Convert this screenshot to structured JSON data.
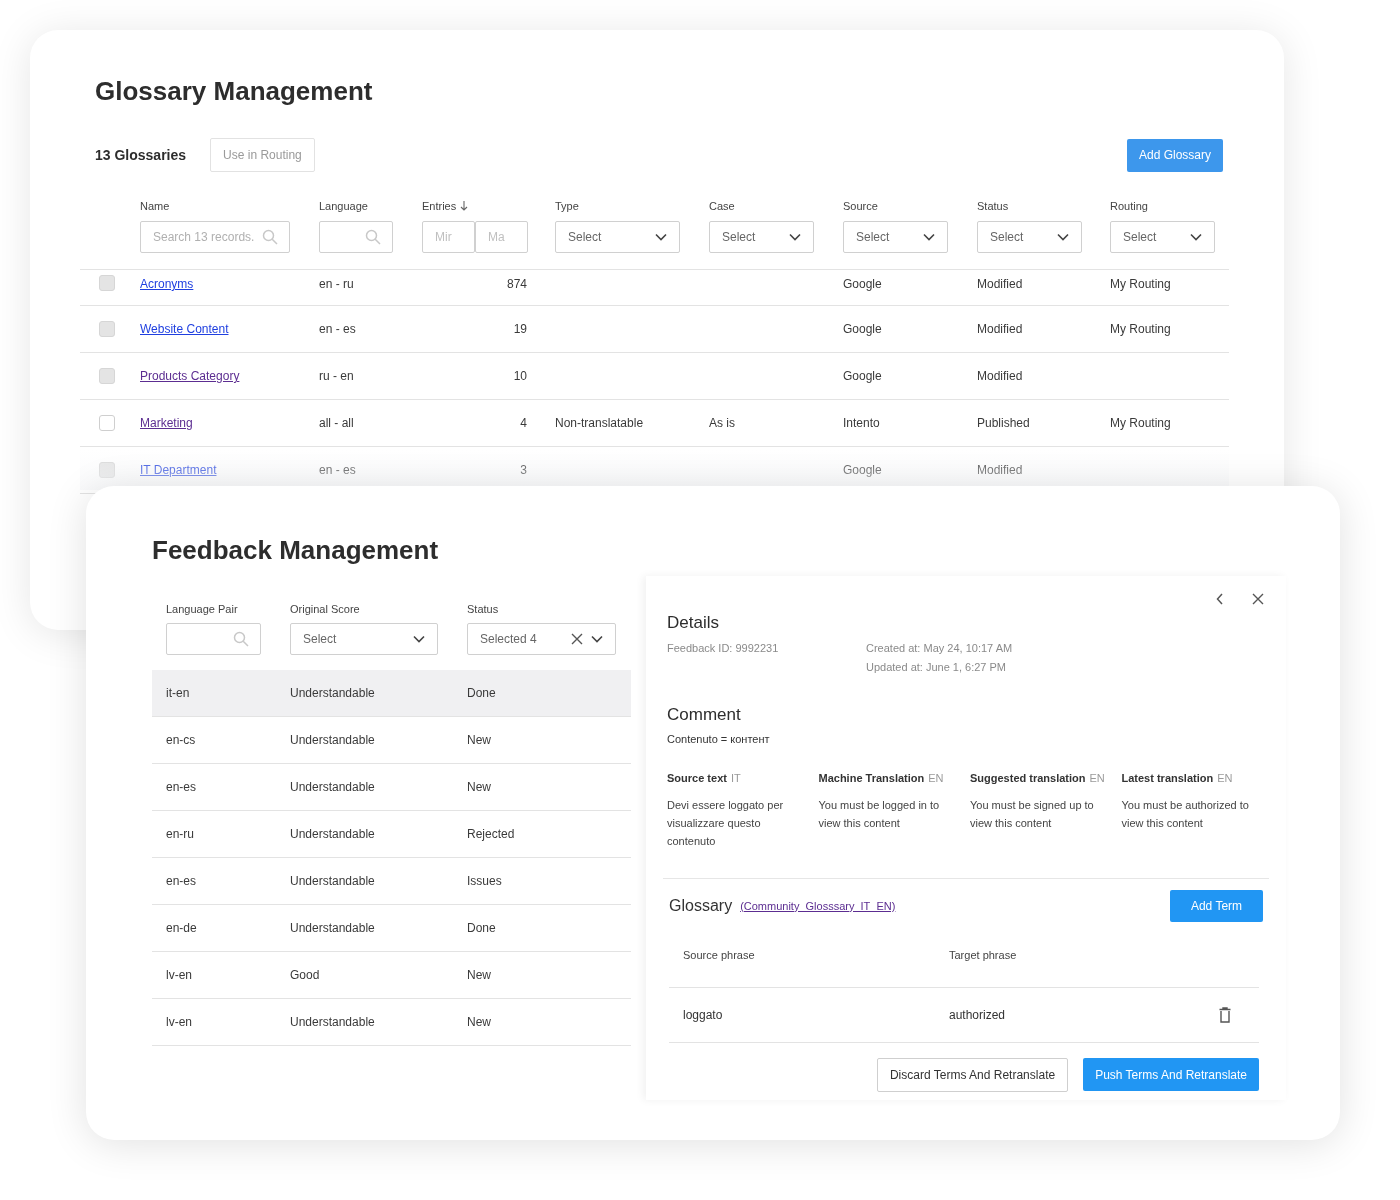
{
  "glossary_window": {
    "title": "Glossary Management",
    "count_label": "13 Glossaries",
    "use_in_routing_button": {
      "label": "Use in Routing",
      "disabled": true
    },
    "add_button": "Add Glossary",
    "columns": [
      {
        "label": "Name",
        "filter": {
          "kind": "search",
          "placeholder": "Search 13 records."
        }
      },
      {
        "label": "Language",
        "filter": {
          "kind": "search"
        }
      },
      {
        "label": "Entries",
        "sorted": true,
        "filter": {
          "kind": "range",
          "placeholders": [
            "Mir",
            "Ma"
          ]
        }
      },
      {
        "label": "Type",
        "filter": {
          "kind": "select",
          "value": "Select"
        }
      },
      {
        "label": "Case",
        "filter": {
          "kind": "select",
          "value": "Select"
        }
      },
      {
        "label": "Source",
        "filter": {
          "kind": "select",
          "value": "Select"
        }
      },
      {
        "label": "Status",
        "filter": {
          "kind": "select",
          "value": "Select"
        }
      },
      {
        "label": "Routing",
        "filter": {
          "kind": "select",
          "value": "Select"
        }
      }
    ],
    "rows": [
      {
        "checked": false,
        "disabled": true,
        "name": "Acronyms",
        "visited": false,
        "language": "en - ru",
        "entries": "874",
        "source": "Google",
        "status": "Modified",
        "routing": "My Routing"
      },
      {
        "checked": false,
        "disabled": true,
        "name": "Website Content",
        "visited": false,
        "language": "en - es",
        "entries": "19",
        "source": "Google",
        "status": "Modified",
        "routing": "My Routing"
      },
      {
        "checked": false,
        "disabled": true,
        "name": "Products Category",
        "visited": true,
        "language": "ru - en",
        "entries": "10",
        "source": "Google",
        "status": "Modified"
      },
      {
        "checked": false,
        "disabled": false,
        "name": "Marketing",
        "visited": true,
        "language": "all - all",
        "entries": "4",
        "type": "Non-translatable",
        "case": "As is",
        "source": "Intento",
        "status": "Published",
        "routing": "My Routing"
      },
      {
        "checked": false,
        "disabled": true,
        "name": "IT Department",
        "visited": false,
        "language": "en - es",
        "entries": "3",
        "source": "Google",
        "status": "Modified"
      }
    ]
  },
  "feedback_window": {
    "title": "Feedback Management",
    "columns": [
      {
        "label": "Language Pair",
        "filter": {
          "kind": "search"
        }
      },
      {
        "label": "Original Score",
        "filter": {
          "kind": "select",
          "value": "Select"
        }
      },
      {
        "label": "Status",
        "filter": {
          "kind": "select",
          "value": "Selected 4",
          "clearable": true
        }
      }
    ],
    "rows": [
      {
        "pair": "it-en",
        "score": "Understandable",
        "status": "Done",
        "selected": true
      },
      {
        "pair": "en-cs",
        "score": "Understandable",
        "status": "New",
        "selected": false
      },
      {
        "pair": "en-es",
        "score": "Understandable",
        "status": "New",
        "selected": false
      },
      {
        "pair": "en-ru",
        "score": "Understandable",
        "status": "Rejected",
        "selected": false
      },
      {
        "pair": "en-es",
        "score": "Understandable",
        "status": "Issues",
        "selected": false
      },
      {
        "pair": "en-de",
        "score": "Understandable",
        "status": "Done",
        "selected": false
      },
      {
        "pair": "lv-en",
        "score": "Good",
        "status": "New",
        "selected": false
      },
      {
        "pair": "lv-en",
        "score": "Understandable",
        "status": "New",
        "selected": false
      }
    ],
    "details": {
      "title": "Details",
      "feedback_id": "Feedback ID: 9992231",
      "created": "Created at: May 24, 10:17 AM",
      "updated": "Updated at: June 1, 6:27 PM",
      "comment_title": "Comment",
      "comment": "Contenuto = контент",
      "translations": [
        {
          "label": "Source text",
          "lang": "IT",
          "text": "Devi essere loggato per visualizzare questo contenuto"
        },
        {
          "label": "Machine Translation",
          "lang": "EN",
          "text": "You must be logged in to view this content"
        },
        {
          "label": "Suggested translation",
          "lang": "EN",
          "text": "You must be signed up to view this content"
        },
        {
          "label": "Latest translation",
          "lang": "EN",
          "text": "You must be authorized to view this content"
        }
      ],
      "glossary": {
        "title": "Glossary",
        "link": "(Community_Glosssary_IT_EN)",
        "visited": true,
        "add_button": "Add Term",
        "columns": [
          "Source phrase",
          "Target phrase"
        ],
        "rows": [
          {
            "source": "loggato",
            "target": "authorized"
          }
        ]
      },
      "buttons": [
        {
          "label": "Discard Terms And Retranslate",
          "kind": "secondary"
        },
        {
          "label": "Push Terms And Retranslate",
          "kind": "primary"
        }
      ]
    }
  }
}
